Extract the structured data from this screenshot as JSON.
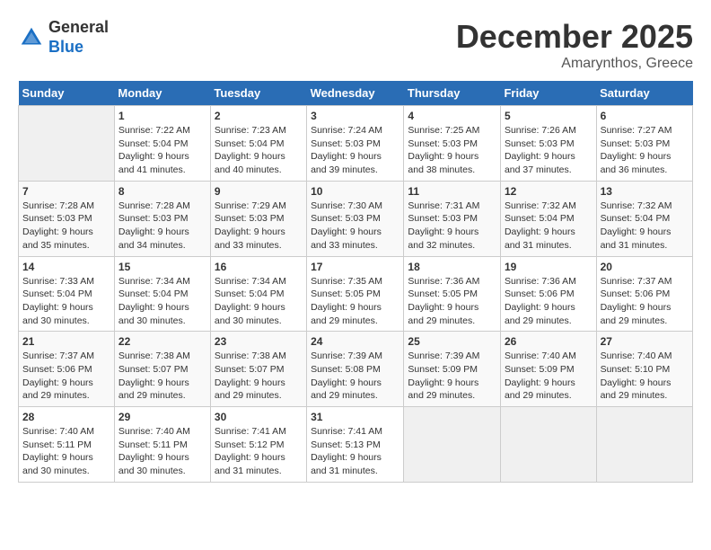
{
  "logo": {
    "general": "General",
    "blue": "Blue"
  },
  "title": "December 2025",
  "location": "Amarynthos, Greece",
  "header_days": [
    "Sunday",
    "Monday",
    "Tuesday",
    "Wednesday",
    "Thursday",
    "Friday",
    "Saturday"
  ],
  "weeks": [
    [
      {
        "day": "",
        "info": ""
      },
      {
        "day": "1",
        "info": "Sunrise: 7:22 AM\nSunset: 5:04 PM\nDaylight: 9 hours\nand 41 minutes."
      },
      {
        "day": "2",
        "info": "Sunrise: 7:23 AM\nSunset: 5:04 PM\nDaylight: 9 hours\nand 40 minutes."
      },
      {
        "day": "3",
        "info": "Sunrise: 7:24 AM\nSunset: 5:03 PM\nDaylight: 9 hours\nand 39 minutes."
      },
      {
        "day": "4",
        "info": "Sunrise: 7:25 AM\nSunset: 5:03 PM\nDaylight: 9 hours\nand 38 minutes."
      },
      {
        "day": "5",
        "info": "Sunrise: 7:26 AM\nSunset: 5:03 PM\nDaylight: 9 hours\nand 37 minutes."
      },
      {
        "day": "6",
        "info": "Sunrise: 7:27 AM\nSunset: 5:03 PM\nDaylight: 9 hours\nand 36 minutes."
      }
    ],
    [
      {
        "day": "7",
        "info": "Sunrise: 7:28 AM\nSunset: 5:03 PM\nDaylight: 9 hours\nand 35 minutes."
      },
      {
        "day": "8",
        "info": "Sunrise: 7:28 AM\nSunset: 5:03 PM\nDaylight: 9 hours\nand 34 minutes."
      },
      {
        "day": "9",
        "info": "Sunrise: 7:29 AM\nSunset: 5:03 PM\nDaylight: 9 hours\nand 33 minutes."
      },
      {
        "day": "10",
        "info": "Sunrise: 7:30 AM\nSunset: 5:03 PM\nDaylight: 9 hours\nand 33 minutes."
      },
      {
        "day": "11",
        "info": "Sunrise: 7:31 AM\nSunset: 5:03 PM\nDaylight: 9 hours\nand 32 minutes."
      },
      {
        "day": "12",
        "info": "Sunrise: 7:32 AM\nSunset: 5:04 PM\nDaylight: 9 hours\nand 31 minutes."
      },
      {
        "day": "13",
        "info": "Sunrise: 7:32 AM\nSunset: 5:04 PM\nDaylight: 9 hours\nand 31 minutes."
      }
    ],
    [
      {
        "day": "14",
        "info": "Sunrise: 7:33 AM\nSunset: 5:04 PM\nDaylight: 9 hours\nand 30 minutes."
      },
      {
        "day": "15",
        "info": "Sunrise: 7:34 AM\nSunset: 5:04 PM\nDaylight: 9 hours\nand 30 minutes."
      },
      {
        "day": "16",
        "info": "Sunrise: 7:34 AM\nSunset: 5:04 PM\nDaylight: 9 hours\nand 30 minutes."
      },
      {
        "day": "17",
        "info": "Sunrise: 7:35 AM\nSunset: 5:05 PM\nDaylight: 9 hours\nand 29 minutes."
      },
      {
        "day": "18",
        "info": "Sunrise: 7:36 AM\nSunset: 5:05 PM\nDaylight: 9 hours\nand 29 minutes."
      },
      {
        "day": "19",
        "info": "Sunrise: 7:36 AM\nSunset: 5:06 PM\nDaylight: 9 hours\nand 29 minutes."
      },
      {
        "day": "20",
        "info": "Sunrise: 7:37 AM\nSunset: 5:06 PM\nDaylight: 9 hours\nand 29 minutes."
      }
    ],
    [
      {
        "day": "21",
        "info": "Sunrise: 7:37 AM\nSunset: 5:06 PM\nDaylight: 9 hours\nand 29 minutes."
      },
      {
        "day": "22",
        "info": "Sunrise: 7:38 AM\nSunset: 5:07 PM\nDaylight: 9 hours\nand 29 minutes."
      },
      {
        "day": "23",
        "info": "Sunrise: 7:38 AM\nSunset: 5:07 PM\nDaylight: 9 hours\nand 29 minutes."
      },
      {
        "day": "24",
        "info": "Sunrise: 7:39 AM\nSunset: 5:08 PM\nDaylight: 9 hours\nand 29 minutes."
      },
      {
        "day": "25",
        "info": "Sunrise: 7:39 AM\nSunset: 5:09 PM\nDaylight: 9 hours\nand 29 minutes."
      },
      {
        "day": "26",
        "info": "Sunrise: 7:40 AM\nSunset: 5:09 PM\nDaylight: 9 hours\nand 29 minutes."
      },
      {
        "day": "27",
        "info": "Sunrise: 7:40 AM\nSunset: 5:10 PM\nDaylight: 9 hours\nand 29 minutes."
      }
    ],
    [
      {
        "day": "28",
        "info": "Sunrise: 7:40 AM\nSunset: 5:11 PM\nDaylight: 9 hours\nand 30 minutes."
      },
      {
        "day": "29",
        "info": "Sunrise: 7:40 AM\nSunset: 5:11 PM\nDaylight: 9 hours\nand 30 minutes."
      },
      {
        "day": "30",
        "info": "Sunrise: 7:41 AM\nSunset: 5:12 PM\nDaylight: 9 hours\nand 31 minutes."
      },
      {
        "day": "31",
        "info": "Sunrise: 7:41 AM\nSunset: 5:13 PM\nDaylight: 9 hours\nand 31 minutes."
      },
      {
        "day": "",
        "info": ""
      },
      {
        "day": "",
        "info": ""
      },
      {
        "day": "",
        "info": ""
      }
    ]
  ]
}
